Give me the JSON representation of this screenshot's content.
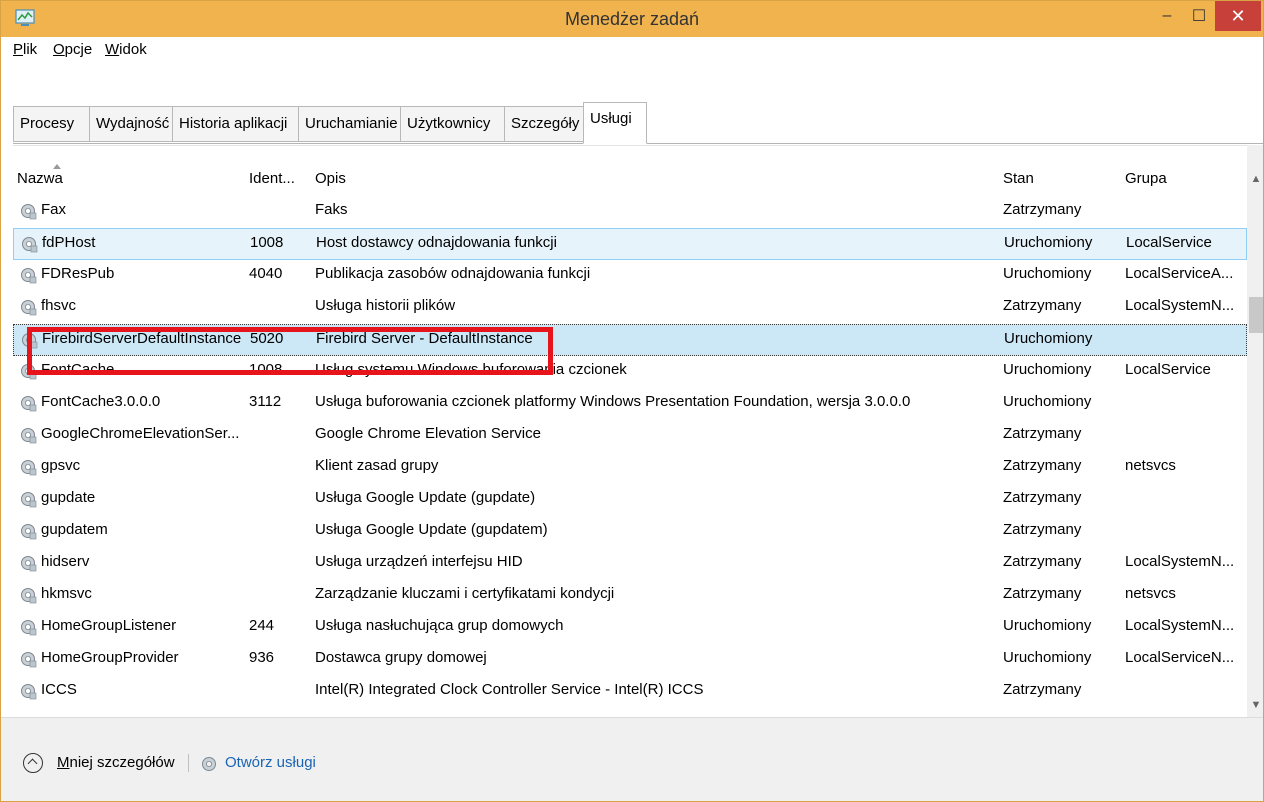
{
  "window": {
    "title": "Menedżer zadań",
    "minimize": "–",
    "maximize": "☐",
    "close": "✕"
  },
  "menu": [
    "Plik",
    "Opcje",
    "Widok"
  ],
  "tabs": [
    "Procesy",
    "Wydajność",
    "Historia aplikacji",
    "Uruchamianie",
    "Użytkownicy",
    "Szczegóły",
    "Usługi"
  ],
  "active_tab": "Usługi",
  "columns": {
    "name": "Nazwa",
    "pid": "Ident...",
    "desc": "Opis",
    "status": "Stan",
    "group": "Grupa"
  },
  "rows": [
    {
      "name": "Fax",
      "pid": "",
      "desc": "Faks",
      "status": "Zatrzymany",
      "group": ""
    },
    {
      "name": "fdPHost",
      "pid": "1008",
      "desc": "Host dostawcy odnajdowania funkcji",
      "status": "Uruchomiony",
      "group": "LocalService"
    },
    {
      "name": "FDResPub",
      "pid": "4040",
      "desc": "Publikacja zasobów odnajdowania funkcji",
      "status": "Uruchomiony",
      "group": "LocalServiceA..."
    },
    {
      "name": "fhsvc",
      "pid": "",
      "desc": "Usługa historii plików",
      "status": "Zatrzymany",
      "group": "LocalSystemN..."
    },
    {
      "name": "FirebirdServerDefaultInstance",
      "pid": "5020",
      "desc": "Firebird Server - DefaultInstance",
      "status": "Uruchomiony",
      "group": ""
    },
    {
      "name": "FontCache",
      "pid": "1008",
      "desc": "Usług systemu Windows buforowania czcionek",
      "status": "Uruchomiony",
      "group": "LocalService"
    },
    {
      "name": "FontCache3.0.0.0",
      "pid": "3112",
      "desc": "Usługa buforowania czcionek platformy Windows Presentation Foundation, wersja 3.0.0.0",
      "status": "Uruchomiony",
      "group": ""
    },
    {
      "name": "GoogleChromeElevationSer...",
      "pid": "",
      "desc": "Google Chrome Elevation Service",
      "status": "Zatrzymany",
      "group": ""
    },
    {
      "name": "gpsvc",
      "pid": "",
      "desc": "Klient zasad grupy",
      "status": "Zatrzymany",
      "group": "netsvcs"
    },
    {
      "name": "gupdate",
      "pid": "",
      "desc": "Usługa Google Update (gupdate)",
      "status": "Zatrzymany",
      "group": ""
    },
    {
      "name": "gupdatem",
      "pid": "",
      "desc": "Usługa Google Update (gupdatem)",
      "status": "Zatrzymany",
      "group": ""
    },
    {
      "name": "hidserv",
      "pid": "",
      "desc": "Usługa urządzeń interfejsu HID",
      "status": "Zatrzymany",
      "group": "LocalSystemN..."
    },
    {
      "name": "hkmsvc",
      "pid": "",
      "desc": "Zarządzanie kluczami i certyfikatami kondycji",
      "status": "Zatrzymany",
      "group": "netsvcs"
    },
    {
      "name": "HomeGroupListener",
      "pid": "244",
      "desc": "Usługa nasłuchująca grup domowych",
      "status": "Uruchomiony",
      "group": "LocalSystemN..."
    },
    {
      "name": "HomeGroupProvider",
      "pid": "936",
      "desc": "Dostawca grupy domowej",
      "status": "Uruchomiony",
      "group": "LocalServiceN..."
    },
    {
      "name": "ICCS",
      "pid": "",
      "desc": "Intel(R) Integrated Clock Controller Service - Intel(R) ICCS",
      "status": "Zatrzymany",
      "group": ""
    }
  ],
  "hovered_row": "fdPHost",
  "selected_row": "FirebirdServerDefaultInstance",
  "footer": {
    "less_details": "Mniej szczegółów",
    "open_services": "Otwórz usługi"
  },
  "colors": {
    "titlebar": "#f1b34e",
    "close_button": "#c7403a",
    "highlight_box": "#e8141b",
    "selection": "#cce8f7",
    "link": "#1a64b5"
  },
  "icons": {
    "app": "task-manager-icon",
    "service": "gear-icon",
    "collapse": "chevron-up-icon"
  }
}
